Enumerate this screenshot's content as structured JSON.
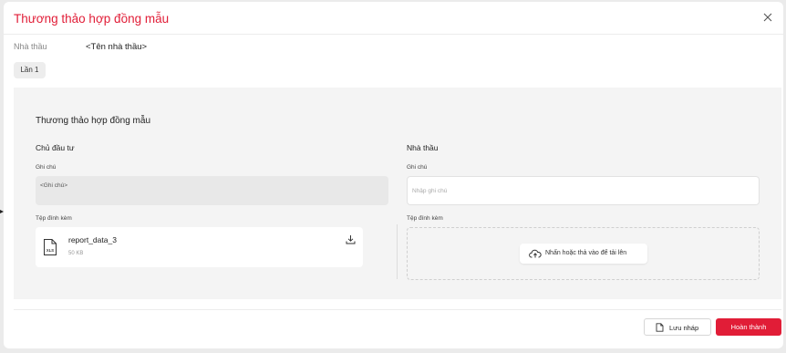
{
  "dialog": {
    "title": "Thương thảo hợp đồng mẫu",
    "close_icon": "close-icon"
  },
  "contractor": {
    "label": "Nhà thầu",
    "value": "<Tên nhà thầu>"
  },
  "round_tab": "Lần 1",
  "section": {
    "title": "Thương thảo hợp đồng mẫu",
    "investor": {
      "title": "Chủ đầu tư",
      "note_label": "Ghi chú",
      "note_value": "<Ghi chú>",
      "attachment_label": "Tệp đính kèm",
      "file": {
        "name": "report_data_3",
        "size": "50 KB",
        "icon": "xls-file-icon",
        "icon_text": "XLS"
      }
    },
    "contractor": {
      "title": "Nhà thầu",
      "note_label": "Ghi chú",
      "note_placeholder": "Nhập ghi chú",
      "attachment_label": "Tệp đính kèm",
      "upload_label": "Nhấn hoặc thả vào để tải lên"
    }
  },
  "footer": {
    "draft_label": "Lưu nháp",
    "done_label": "Hoàn thành"
  },
  "colors": {
    "accent": "#e11d37",
    "panel_bg": "#f4f4f4"
  }
}
